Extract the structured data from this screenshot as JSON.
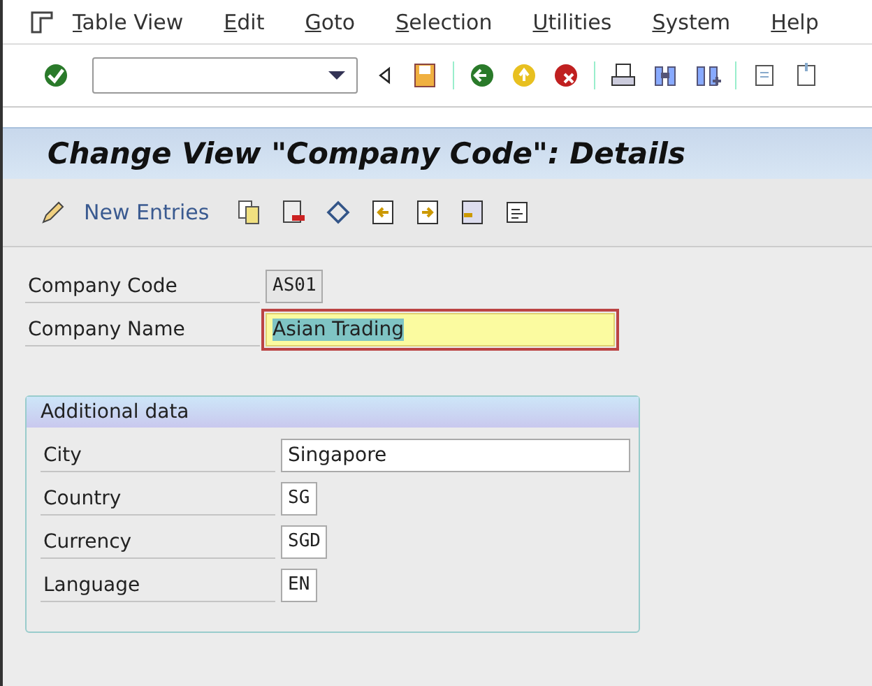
{
  "menu": [
    "Table View",
    "Edit",
    "Goto",
    "Selection",
    "Utilities",
    "System",
    "Help"
  ],
  "screen_title": "Change View \"Company Code\": Details",
  "app_toolbar": {
    "new_entries": "New Entries"
  },
  "fields": [
    {
      "label": "Company Code",
      "value": "AS01",
      "kind": "code",
      "readonly": true,
      "focused": false
    },
    {
      "label": "Company Name",
      "value": "Asian Trading",
      "kind": "text",
      "readonly": false,
      "focused": true
    }
  ],
  "group": {
    "title": "Additional data",
    "fields": [
      {
        "label": "City",
        "value": "Singapore",
        "kind": "text",
        "readonly": false,
        "focused": false
      },
      {
        "label": "Country",
        "value": "SG",
        "kind": "code",
        "readonly": false,
        "focused": false
      },
      {
        "label": "Currency",
        "value": "SGD",
        "kind": "code",
        "readonly": false,
        "focused": false
      },
      {
        "label": "Language",
        "value": "EN",
        "kind": "code",
        "readonly": false,
        "focused": false
      }
    ]
  }
}
